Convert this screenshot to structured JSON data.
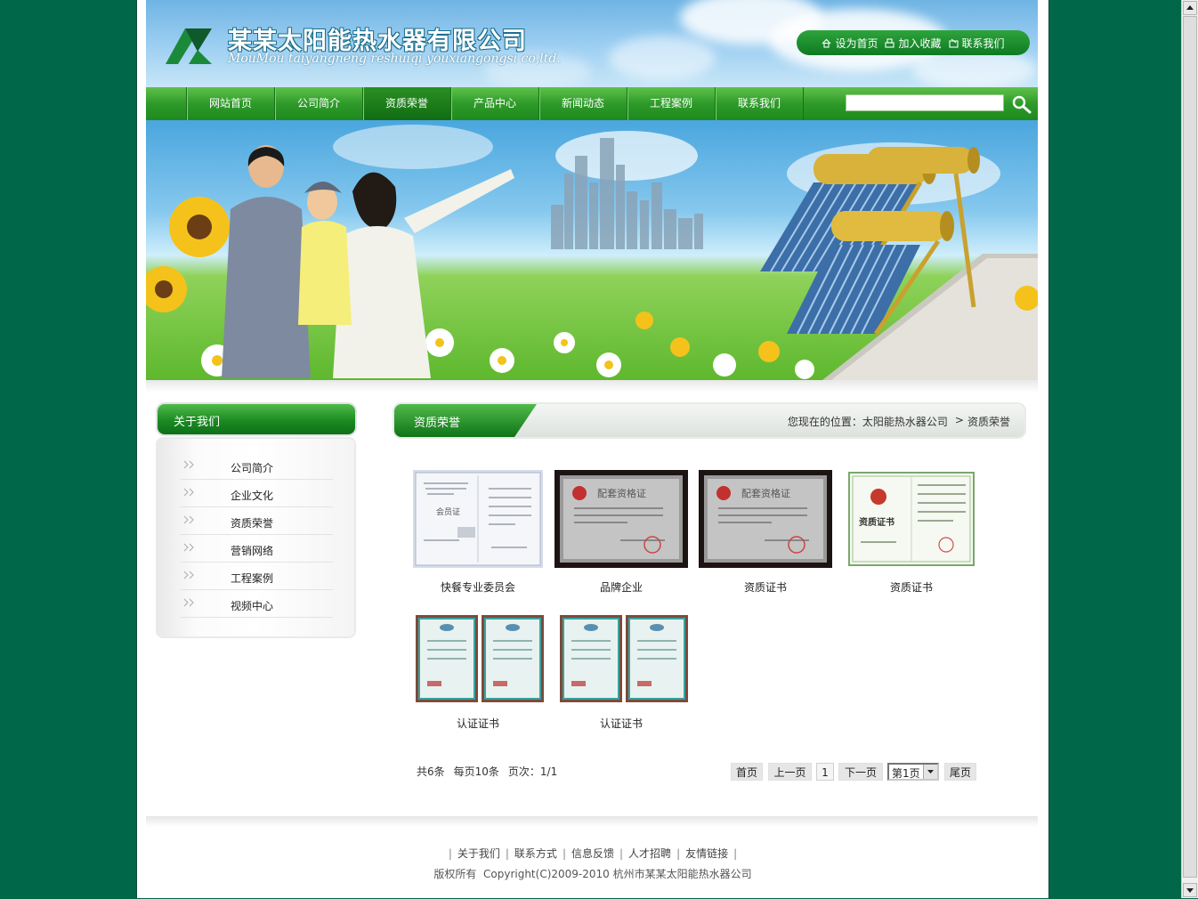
{
  "header": {
    "company_name": "某某太阳能热水器有限公司",
    "company_name_en": "MouMou taiyangneng reshuiqi youxiangongsi co,ltd.",
    "top_links": [
      {
        "icon": "home-icon",
        "label": "设为首页"
      },
      {
        "icon": "favorite-icon",
        "label": "加入收藏"
      },
      {
        "icon": "contact-icon",
        "label": "联系我们"
      }
    ]
  },
  "nav": {
    "items": [
      "网站首页",
      "公司简介",
      "资质荣誉",
      "产品中心",
      "新闻动态",
      "工程案例",
      "联系我们"
    ],
    "active_index": 2,
    "search_value": "",
    "search_icon": "search-icon"
  },
  "sidebar": {
    "title": "关于我们",
    "items": [
      "公司简介",
      "企业文化",
      "资质荣誉",
      "营销网络",
      "工程案例",
      "视频中心"
    ]
  },
  "main": {
    "title": "资质荣誉",
    "breadcrumb": {
      "prefix": "您现在的位置：",
      "home": "太阳能热水器公司",
      "separator": ">",
      "current": "资质荣誉"
    },
    "certificates": [
      {
        "caption": "快餐专业委员会",
        "style": "white-cert",
        "cert_title": "会员证"
      },
      {
        "caption": "品牌企业",
        "style": "dark-frame",
        "cert_title": "配套资格证"
      },
      {
        "caption": "资质证书",
        "style": "dark-frame",
        "cert_title": "配套资格证"
      },
      {
        "caption": "资质证书",
        "style": "green-cert",
        "cert_title": "资质证书"
      },
      {
        "caption": "认证证书",
        "style": "double-frame",
        "cert_title": ""
      },
      {
        "caption": "认证证书",
        "style": "double-frame",
        "cert_title": ""
      }
    ]
  },
  "pager": {
    "total": "共6条",
    "per_page": "每页10条",
    "page_info": "页次：1/1",
    "first": "首页",
    "prev": "上一页",
    "current": "1",
    "next": "下一页",
    "select_value": "第1页",
    "last": "尾页"
  },
  "footer": {
    "links": [
      "关于我们",
      "联系方式",
      "信息反馈",
      "人才招聘",
      "友情链接"
    ],
    "copyright": "版权所有  Copyright(C)2009-2010 杭州市某某太阳能热水器公司"
  },
  "colors": {
    "page_background": "#006848",
    "nav_green": "#2e9a2a",
    "title_green": "#1b8a22"
  }
}
